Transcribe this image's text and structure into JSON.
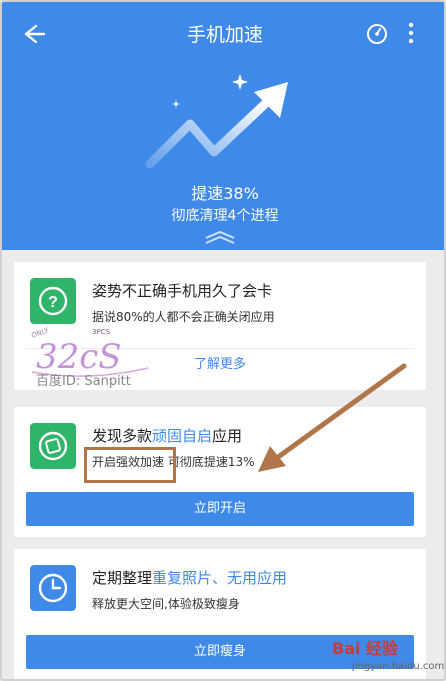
{
  "header": {
    "title": "手机加速",
    "main_text": "提速38%",
    "sub_text": "彻底清理4个进程"
  },
  "cards": [
    {
      "title": "姿势不正确手机用久了会卡",
      "desc": "据说80%的人都不会正确关闭应用",
      "action": "了解更多"
    },
    {
      "title_parts": [
        "发现多款",
        "顽固自启",
        "应用"
      ],
      "desc": "开启强效加速 可彻底提速13%",
      "action": "立即开启"
    },
    {
      "title_parts": [
        "定期整理",
        "重复照片、无用应用"
      ],
      "desc": "释放更大空间,体验极致瘦身",
      "action": "立即瘦身"
    }
  ],
  "watermark": {
    "text": "百度ID: Sanpitt",
    "logo_letters": "32cS",
    "logo_small": "ONLY 3PCS"
  },
  "baidu": {
    "logo": "Bai 经验",
    "url": "jingyan.baidu.com"
  },
  "colors": {
    "primary": "#3f89e8",
    "card_bg": "#ffffff",
    "page_bg": "#ececee",
    "annotation": "#b1754a",
    "icon_green": "#2fb56a",
    "icon_blue": "#3f89e8"
  },
  "icons": [
    "back-arrow-icon",
    "speedometer-icon",
    "more-vertical-icon",
    "question-icon",
    "clean-app-icon",
    "clock-icon"
  ]
}
